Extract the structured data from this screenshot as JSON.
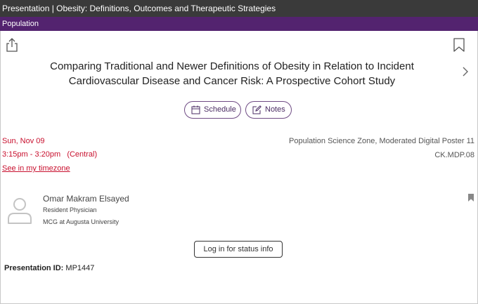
{
  "header": {
    "title": "Presentation | Obesity: Definitions, Outcomes and Therapeutic Strategies",
    "category": "Population"
  },
  "icons": {
    "share": "share-icon",
    "bookmark": "bookmark-icon",
    "next": "chevron-right-icon",
    "calendar": "calendar-icon",
    "notes": "edit-note-icon",
    "avatar": "person-icon",
    "speaker_bookmark": "bookmark-filled-icon"
  },
  "presentation": {
    "title": "Comparing Traditional and Newer Definitions of Obesity in Relation to Incident Cardiovascular Disease and Cancer Risk: A Prospective Cohort Study",
    "schedule_label": "Schedule",
    "notes_label": "Notes",
    "date": "Sun, Nov 09",
    "time": "3:15pm - 3:20pm   (Central)",
    "timezone_link": "See in my timezone",
    "location": "Population Science Zone, Moderated Digital Poster 11",
    "code": "CK.MDP.08"
  },
  "speaker": {
    "name": "Omar Makram Elsayed",
    "role": "Resident Physician",
    "organization": "MCG at Augusta University"
  },
  "login_button": "Log in for status info",
  "presentation_id": {
    "label": "Presentation ID:",
    "value": "MP1447"
  },
  "colors": {
    "topbar": "#3a3a3a",
    "category_bar": "#53236f",
    "accent_red": "#c8102e",
    "pill_border": "#6f4b84"
  }
}
